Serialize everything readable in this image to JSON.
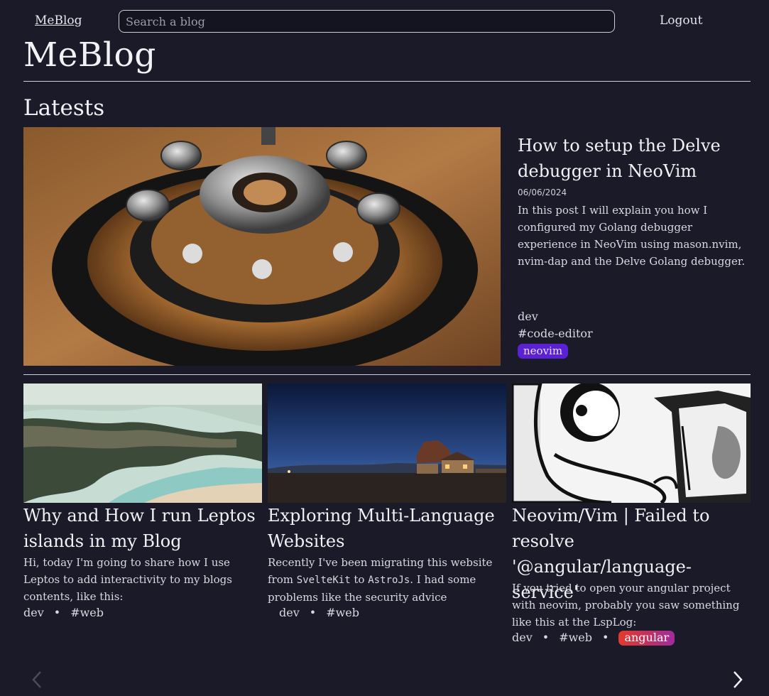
{
  "nav": {
    "brand": "MeBlog",
    "search_placeholder": "Search a blog",
    "logout": "Logout"
  },
  "page_title": "MeBlog",
  "section_title": "Latests",
  "featured": {
    "title": "How to setup the Delve debugger in NeoVim",
    "date": "06/06/2024",
    "description": "In this post I will explain you how I configured my Golang debugger experience in NeoVim using mason.nvim, nvim-dap and the Delve Golang debugger.",
    "category": "dev",
    "tag": "#code-editor",
    "badge": "neovim",
    "badge_color": "#5b21d6"
  },
  "posts": [
    {
      "title": "Why and How I run Leptos islands in my Blog",
      "description": "Hi, today I'm going to share how I use Leptos to add interactivity to my blogs contents, like this:",
      "category": "dev",
      "tag": "#web"
    },
    {
      "title": "Exploring Multi-Language Websites",
      "description_pre": "Recently I've been migrating this website from",
      "code1": "SvelteKit",
      "description_mid": "to",
      "code2": "AstroJs",
      "description_post": ". I had some problems like the security advice",
      "category": "dev",
      "tag": "#web"
    },
    {
      "title": "Neovim/Vim | Failed to resolve '@angular/language-service'",
      "description": "If you tried to open your angular project with neovim, probably you saw something like this at the LspLog:",
      "category": "dev",
      "tag": "#web",
      "badge": "angular"
    }
  ],
  "separator": "•",
  "carousel": {
    "prev_icon": "chevron-left-icon",
    "next_icon": "chevron-right-icon"
  }
}
